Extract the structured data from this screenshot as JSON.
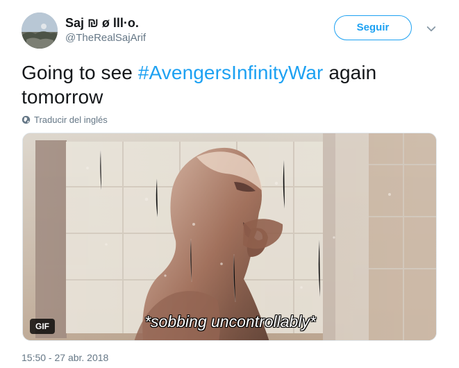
{
  "tweet": {
    "display_name": "Saj ₪ ø lll·o.",
    "handle": "@TheRealSajArif",
    "text_before": "Going to see ",
    "hashtag": "#AvengersInfinityWar",
    "text_after": " again tomorrow",
    "translate_label": "Traducir del inglés",
    "follow_label": "Seguir",
    "timestamp": "15:50 - 27 abr. 2018",
    "media": {
      "badge": "GIF",
      "caption": "*sobbing uncontrollably*"
    }
  },
  "colors": {
    "accent": "#1da1f2",
    "secondary_text": "#657786",
    "primary_text": "#14171a"
  },
  "icons": {
    "menu": "chevron-down-icon",
    "translate": "globe-icon"
  }
}
